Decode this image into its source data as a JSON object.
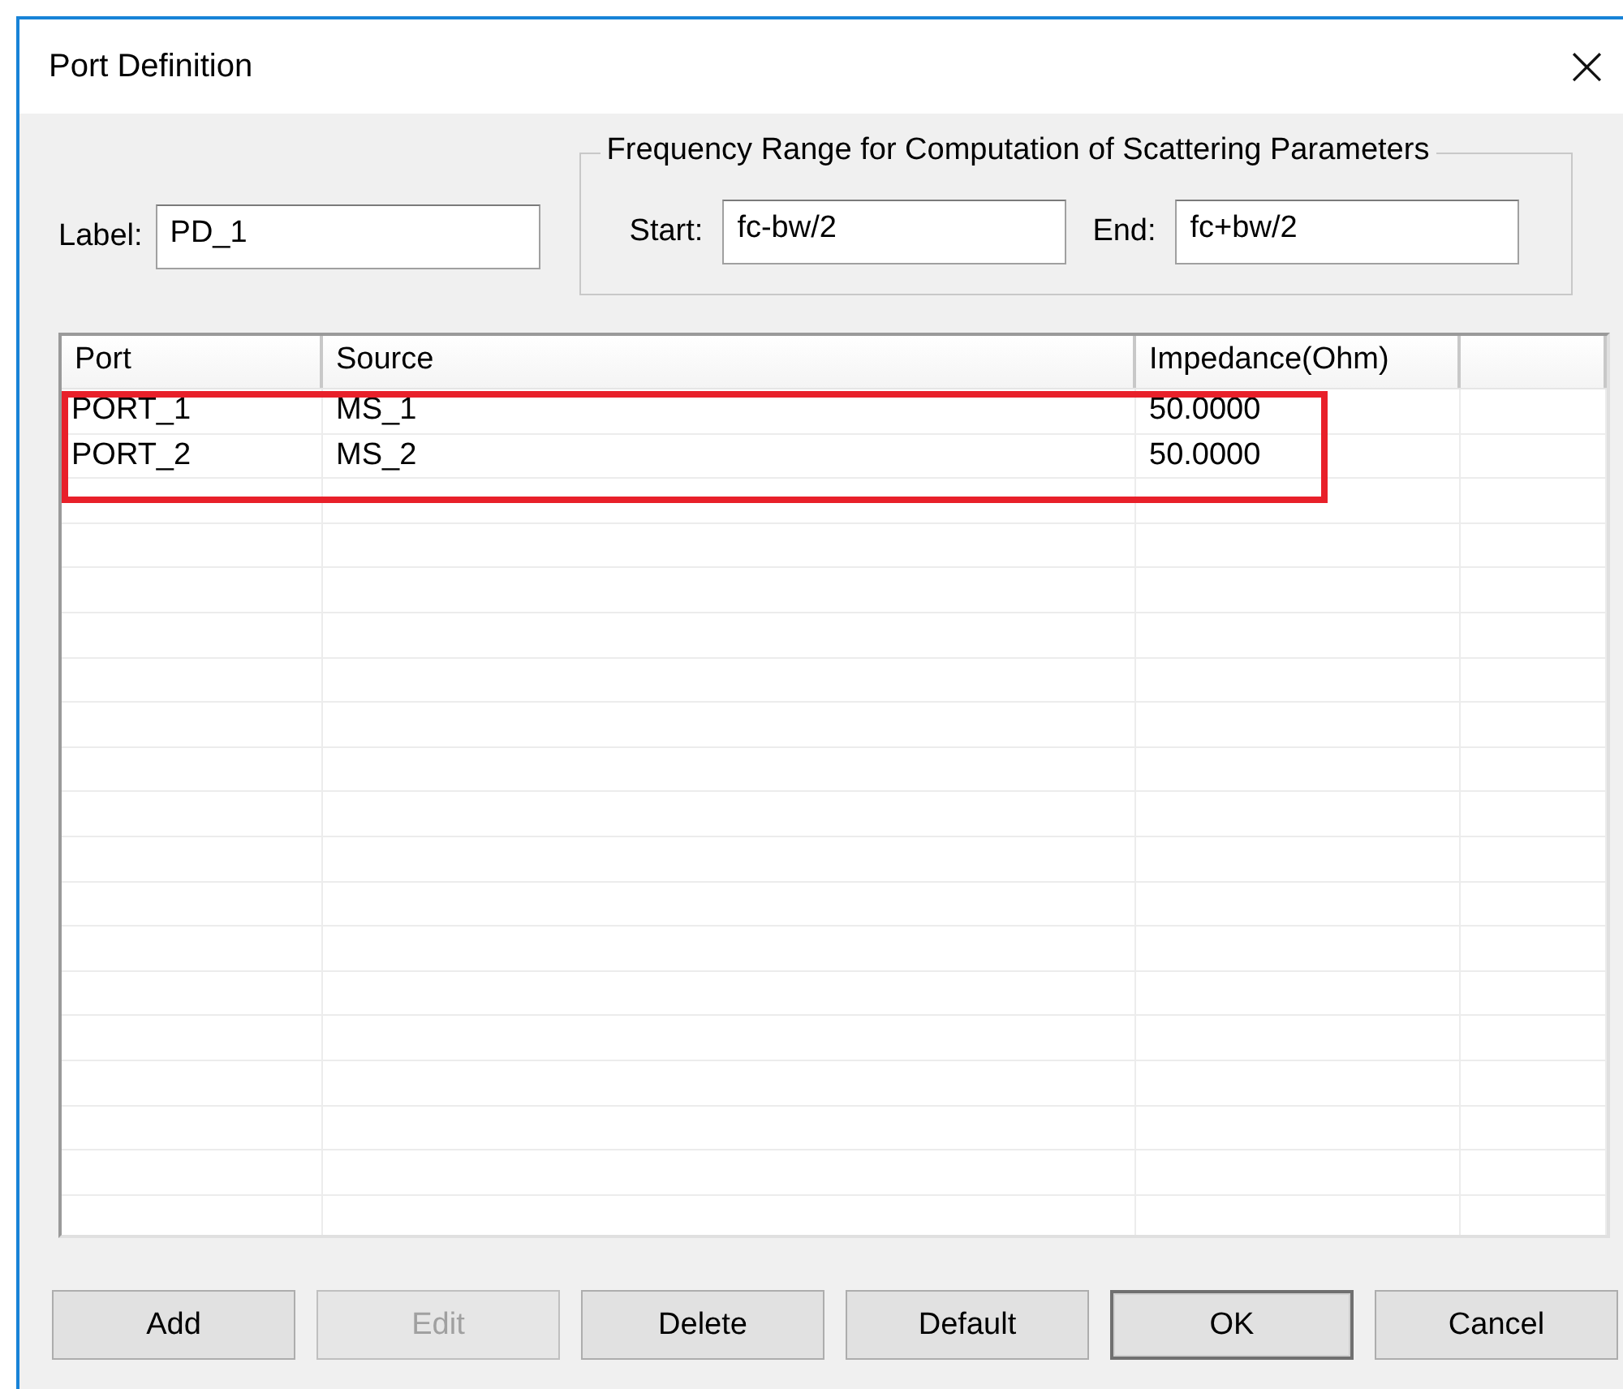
{
  "window": {
    "title": "Port Definition",
    "close": "×"
  },
  "label_field": {
    "label": "Label:",
    "value": "PD_1"
  },
  "frequency_range": {
    "title": "Frequency Range for Computation of Scattering Parameters",
    "start_label": "Start:",
    "start_value": "fc-bw/2",
    "end_label": "End:",
    "end_value": "fc+bw/2"
  },
  "table": {
    "columns": [
      "Port",
      "Source",
      "Impedance(Ohm)"
    ],
    "rows": [
      {
        "port": "PORT_1",
        "source": "MS_1",
        "impedance": "50.0000"
      },
      {
        "port": "PORT_2",
        "source": "MS_2",
        "impedance": "50.0000"
      }
    ]
  },
  "buttons": [
    {
      "label": "Add",
      "disabled": false,
      "default": false
    },
    {
      "label": "Edit",
      "disabled": true,
      "default": false
    },
    {
      "label": "Delete",
      "disabled": false,
      "default": false
    },
    {
      "label": "Default",
      "disabled": false,
      "default": false
    },
    {
      "label": "OK",
      "disabled": false,
      "default": true
    },
    {
      "label": "Cancel",
      "disabled": false,
      "default": false
    }
  ]
}
